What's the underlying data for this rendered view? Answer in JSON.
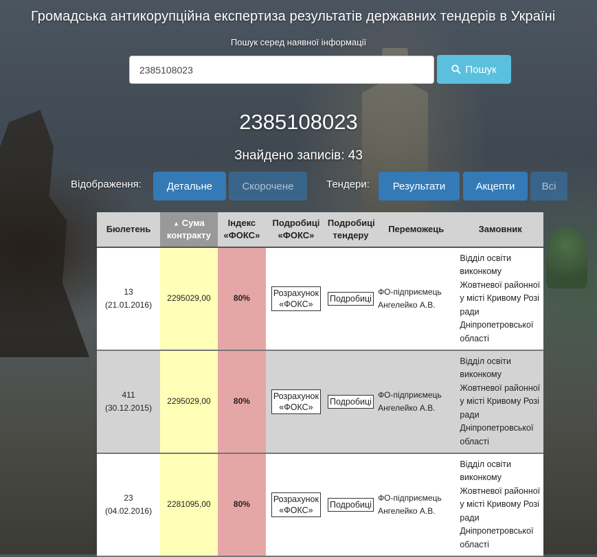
{
  "site_title": "Громадська антикорупційна експертиза результатів державних тендерів в Україні",
  "search": {
    "label": "Пошук серед наявної інформації",
    "value": "2385108023",
    "button_label": "Пошук",
    "button_icon": "search-icon"
  },
  "query_heading": "2385108023",
  "found_text": "Знайдено записів: 43",
  "display_mode": {
    "label": "Відображення:",
    "options": [
      "Детальне",
      "Скорочене"
    ],
    "active": "Детальне"
  },
  "tenders_filter": {
    "label": "Тендери:",
    "options": [
      "Результати",
      "Акцепти",
      "Всі"
    ],
    "active": [
      "Результати",
      "Акцепти"
    ]
  },
  "table": {
    "headers": {
      "bulletin": "Бюлетень",
      "sum_arrow": "▲",
      "sum_line1": "Сума",
      "sum_line2": "контракту",
      "index_line1": "Індекс",
      "index_line2": "«ФОКС»",
      "fox_details_line1": "Подробиці",
      "fox_details_line2": "«ФОКС»",
      "tender_details_line1": "Подробиці",
      "tender_details_line2": "тендеру",
      "winner": "Переможець",
      "customer": "Замовник"
    },
    "sorted_column": "Сума контракту",
    "rows": [
      {
        "bulletin_no": "13",
        "bulletin_date": "(21.01.2016)",
        "sum": "2295029,00",
        "index": "80%",
        "fox_line1": "Розрахунок",
        "fox_line2": "«ФОКС»",
        "details": "Подробиці",
        "winner": "ФО-підприємець Ангелейко А.В.",
        "customer": "Відділ освіти виконкому Жовтневої районної у місті Кривому Розі ради Дніпропетровської області"
      },
      {
        "bulletin_no": "411",
        "bulletin_date": "(30.12.2015)",
        "sum": "2295029,00",
        "index": "80%",
        "fox_line1": "Розрахунок",
        "fox_line2": "«ФОКС»",
        "details": "Подробиці",
        "winner": "ФО-підприємець Ангелейко А.В.",
        "customer": "Відділ освіти виконкому Жовтневої районної у місті Кривому Розі ради Дніпропетровської області"
      },
      {
        "bulletin_no": "23",
        "bulletin_date": "(04.02.2016)",
        "sum": "2281095,00",
        "index": "80%",
        "fox_line1": "Розрахунок",
        "fox_line2": "«ФОКС»",
        "details": "Подробиці",
        "winner": "ФО-підприємець Ангелейко А.В.",
        "customer": "Відділ освіти виконкому Жовтневої районної у місті Кривому Розі ради Дніпропетровської області"
      }
    ]
  },
  "colors": {
    "primary_button": "#337ab7",
    "search_button": "#5bc0de",
    "sum_column": "#ffffb7",
    "index_column": "#e5a6a6",
    "row_alt": "#d3d3d3"
  }
}
